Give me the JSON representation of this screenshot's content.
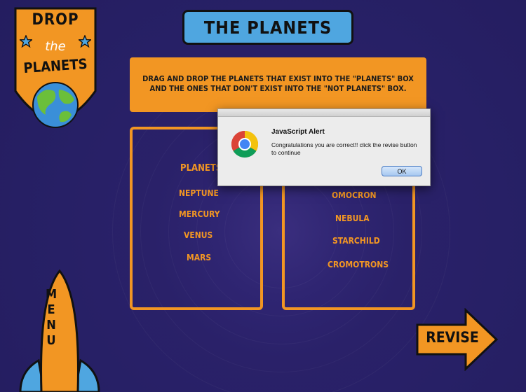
{
  "logo": {
    "line1": "DROP",
    "line2": "the",
    "line3": "PLANETS"
  },
  "title": "THE PLANETS",
  "instructions": "DRAG AND DROP THE PLANETS THAT EXIST INTO THE \"PLANETS\" BOX AND THE ONES THAT DON'T EXIST INTO THE \"NOT PLANETS\" BOX.",
  "planets_box": {
    "heading": "PLANETS",
    "items": [
      "NEPTUNE",
      "MERCURY",
      "VENUS",
      "MARS"
    ]
  },
  "not_planets_box": {
    "items": [
      "OMOCRON",
      "NEBULA",
      "STARCHILD",
      "CROMOTRONS"
    ]
  },
  "menu_label": [
    "M",
    "E",
    "N",
    "U"
  ],
  "revise_label": "REVISE",
  "alert": {
    "title": "JavaScript Alert",
    "message": "Congratulations you are correct!! click the revise button to continue",
    "ok_label": "OK"
  },
  "colors": {
    "background": "#2a2169",
    "orange": "#f29623",
    "title_blue": "#4fa6e0",
    "earth_land": "#6bbf3a",
    "earth_water": "#3a8fd8"
  },
  "icons": [
    "star-icon",
    "earth-icon",
    "rocket-icon",
    "arrow-right-icon",
    "chrome-icon"
  ]
}
